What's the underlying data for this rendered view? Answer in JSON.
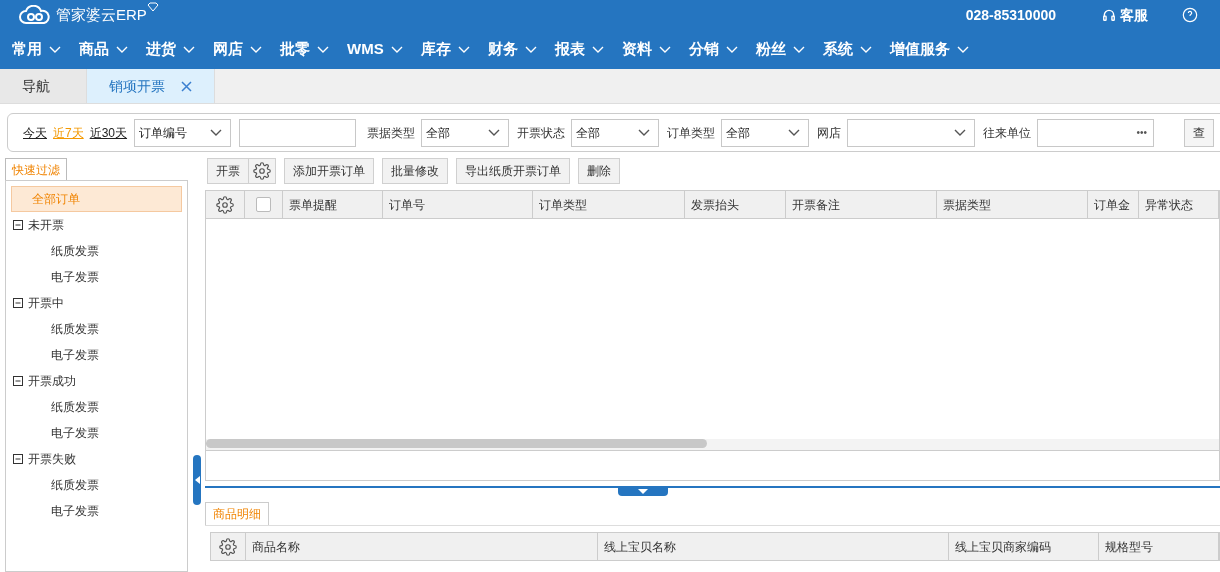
{
  "header": {
    "logo_text": "管家婆云ERP",
    "phone": "028-85310000",
    "service": "客服"
  },
  "menu": [
    "常用",
    "商品",
    "进货",
    "网店",
    "批零",
    "WMS",
    "库存",
    "财务",
    "报表",
    "资料",
    "分销",
    "粉丝",
    "系统",
    "增值服务"
  ],
  "tabs": [
    {
      "label": "导航",
      "selected": false,
      "closable": false
    },
    {
      "label": "销项开票",
      "selected": true,
      "closable": true
    }
  ],
  "filter": {
    "quick_dates": [
      {
        "label": "今天",
        "selected": false
      },
      {
        "label": "近7天",
        "selected": true
      },
      {
        "label": "近30天",
        "selected": false
      }
    ],
    "search_by": "订单编号",
    "fields": [
      {
        "label": "票据类型",
        "value": "全部"
      },
      {
        "label": "开票状态",
        "value": "全部"
      },
      {
        "label": "订单类型",
        "value": "全部"
      },
      {
        "label": "网店"
      }
    ],
    "partner_label": "往来单位",
    "partner_more": "•••",
    "query_button": "查"
  },
  "quick_filter": {
    "tab": "快速过滤",
    "tree": [
      {
        "label": "全部订单",
        "selected": true
      },
      {
        "label": "未开票",
        "selected": false,
        "expanded": true,
        "children": [
          {
            "label": "纸质发票",
            "selected": false
          },
          {
            "label": "电子发票",
            "selected": false
          }
        ]
      },
      {
        "label": "开票中",
        "selected": false,
        "expanded": true,
        "children": [
          {
            "label": "纸质发票",
            "selected": false
          },
          {
            "label": "电子发票",
            "selected": false
          }
        ]
      },
      {
        "label": "开票成功",
        "selected": false,
        "expanded": true,
        "children": [
          {
            "label": "纸质发票",
            "selected": false
          },
          {
            "label": "电子发票",
            "selected": false
          }
        ]
      },
      {
        "label": "开票失败",
        "selected": false,
        "expanded": true,
        "children": [
          {
            "label": "纸质发票",
            "selected": false
          },
          {
            "label": "电子发票",
            "selected": false
          }
        ]
      }
    ]
  },
  "toolbar": [
    "开票",
    "添加开票订单",
    "批量修改",
    "导出纸质开票订单",
    "删除"
  ],
  "orders_table": {
    "select_all_checked": false,
    "columns": [
      "票单提醒",
      "订单号",
      "订单类型",
      "发票抬头",
      "开票备注",
      "票据类型",
      "订单金",
      "异常状态"
    ]
  },
  "detail": {
    "tab": "商品明细",
    "columns": [
      "商品名称",
      "线上宝贝名称",
      "线上宝贝商家编码",
      "规格型号"
    ]
  }
}
